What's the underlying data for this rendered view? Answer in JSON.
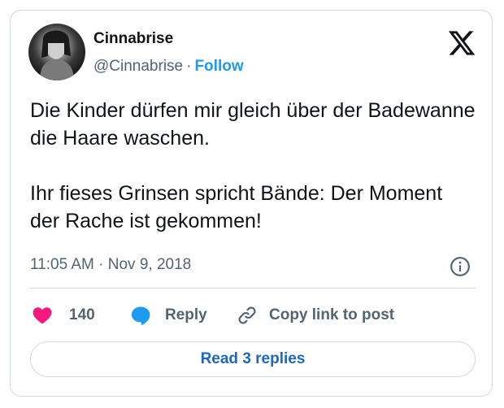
{
  "tweet": {
    "display_name": "Cinnabrise",
    "handle": "@Cinnabrise",
    "separator": "·",
    "follow_label": "Follow",
    "text": "Die Kinder dürfen mir gleich über der Badewanne die Haare waschen.\n\nIhr fieses Grinsen spricht Bände: Der Moment der Rache ist gekommen!",
    "timestamp": "11:05 AM · Nov 9, 2018"
  },
  "actions": {
    "like_count": "140",
    "reply_label": "Reply",
    "copy_link_label": "Copy link to post"
  },
  "footer": {
    "read_replies_label": "Read 3 replies"
  },
  "colors": {
    "accent": "#1d9bf0",
    "like": "#f91880",
    "reply_icon": "#1d9bf0",
    "read_button_text": "#1d67c4",
    "secondary_text": "#536471"
  },
  "icons": [
    "x-logo-icon",
    "info-icon",
    "heart-icon",
    "reply-bubble-icon",
    "link-icon"
  ]
}
